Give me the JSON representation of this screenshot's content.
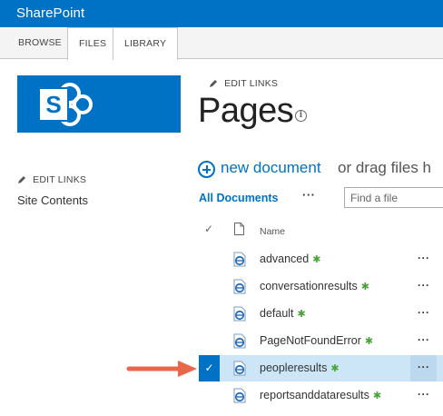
{
  "suite_bar": {
    "brand": "SharePoint"
  },
  "ribbon": {
    "tabs": [
      {
        "label": "BROWSE"
      },
      {
        "label": "FILES"
      },
      {
        "label": "LIBRARY"
      }
    ]
  },
  "header": {
    "edit_links": "EDIT LINKS",
    "title": "Pages"
  },
  "quick_launch": {
    "edit_links": "EDIT LINKS",
    "site_contents": "Site Contents"
  },
  "toolbar": {
    "new_document": "new document",
    "drag_text": "or drag files h",
    "view_label": "All Documents",
    "ellipsis": "···",
    "search_placeholder": "Find a file"
  },
  "list": {
    "column_name": "Name",
    "rows": [
      {
        "name": "advanced",
        "new": true,
        "selected": false
      },
      {
        "name": "conversationresults",
        "new": true,
        "selected": false
      },
      {
        "name": "default",
        "new": true,
        "selected": false
      },
      {
        "name": "PageNotFoundError",
        "new": true,
        "selected": false
      },
      {
        "name": "peopleresults",
        "new": true,
        "selected": true
      },
      {
        "name": "reportsanddataresults",
        "new": true,
        "selected": false
      }
    ],
    "row_ellipsis": "···"
  },
  "colors": {
    "brand_blue": "#0072c6",
    "selected_row": "#cde6f7",
    "arrow": "#e8674a",
    "new_badge": "#4aa33a"
  },
  "icons": [
    "sharepoint-logo-icon",
    "pencil-icon",
    "info-icon",
    "plus-circle-icon",
    "checkmark-icon",
    "document-icon",
    "aspx-file-icon",
    "new-badge-icon",
    "ellipsis-icon",
    "pointer-arrow"
  ]
}
